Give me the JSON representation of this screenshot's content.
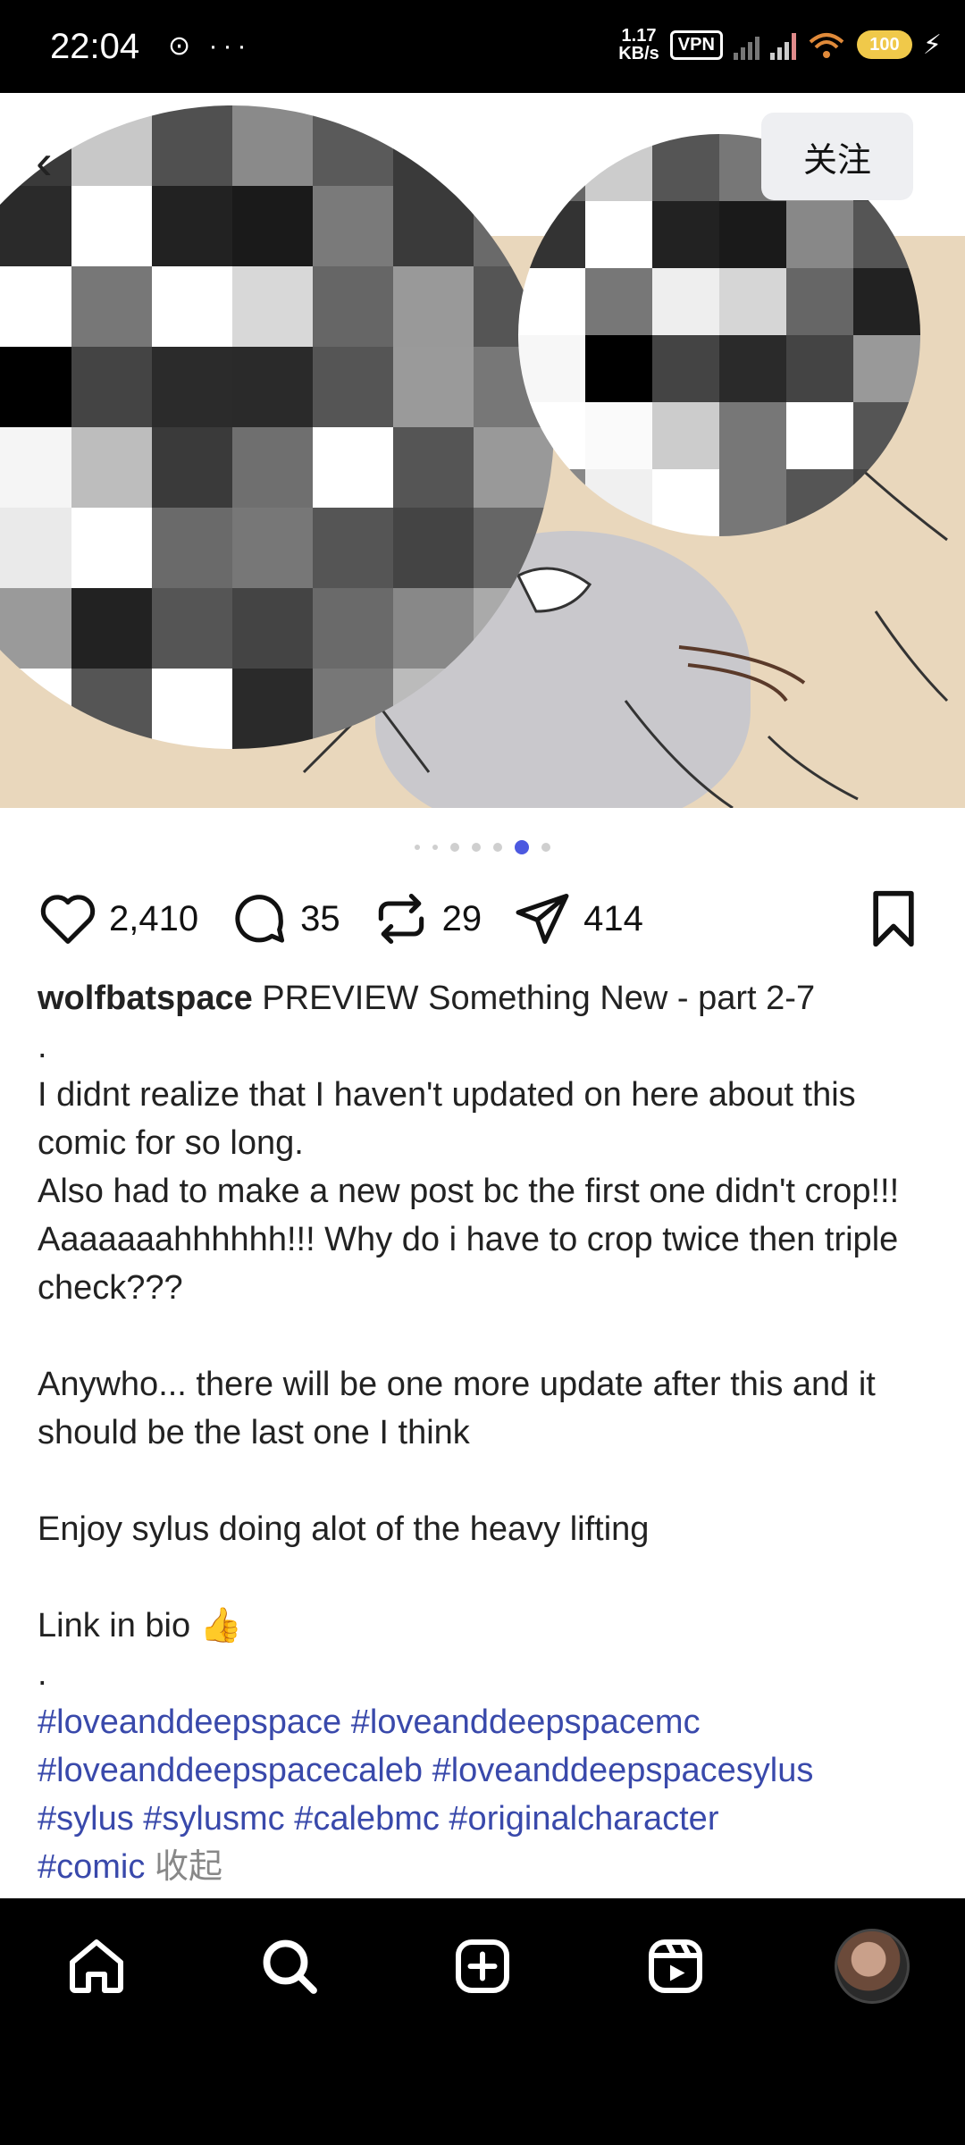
{
  "status_bar": {
    "time": "22:04",
    "left_icons": "⊙ ···",
    "speed_value": "1.17",
    "speed_unit": "KB/s",
    "vpn": "VPN",
    "battery": "100"
  },
  "post_header": {
    "follow_label": "关注"
  },
  "carousel": {
    "count": 7,
    "active_index": 5
  },
  "actions": {
    "likes": "2,410",
    "comments": "35",
    "reposts": "29",
    "shares": "414"
  },
  "caption": {
    "username": "wolfbatspace",
    "title": "PREVIEW Something New - part 2-7",
    "line_dot1": ".",
    "body1": "I didnt realize that I haven't updated on here about this comic for so long.",
    "body2": "Also had to make a new post bc the first one didn't crop!!! Aaaaaaahhhhhh!!! Why do i have to crop twice then triple check???",
    "body3": "Anywho... there will be one more update after this and it should be the last one I think",
    "body4": "Enjoy sylus doing alot of the heavy lifting",
    "body5": "Link in bio 👍",
    "line_dot2": ".",
    "hashtags": [
      "#loveanddeepspace",
      "#loveanddeepspacemc",
      "#loveanddeepspacecaleb",
      "#loveanddeepspacesylus",
      "#sylus",
      "#sylusmc",
      "#calebmc",
      "#originalcharacter",
      "#comic"
    ],
    "collapse_label": "收起"
  },
  "nav": {
    "items": [
      "home",
      "search",
      "create",
      "reels",
      "profile"
    ]
  },
  "colors": {
    "accent": "#4c59e0",
    "hashtag": "#3949ab",
    "nav_bg": "#000000"
  }
}
